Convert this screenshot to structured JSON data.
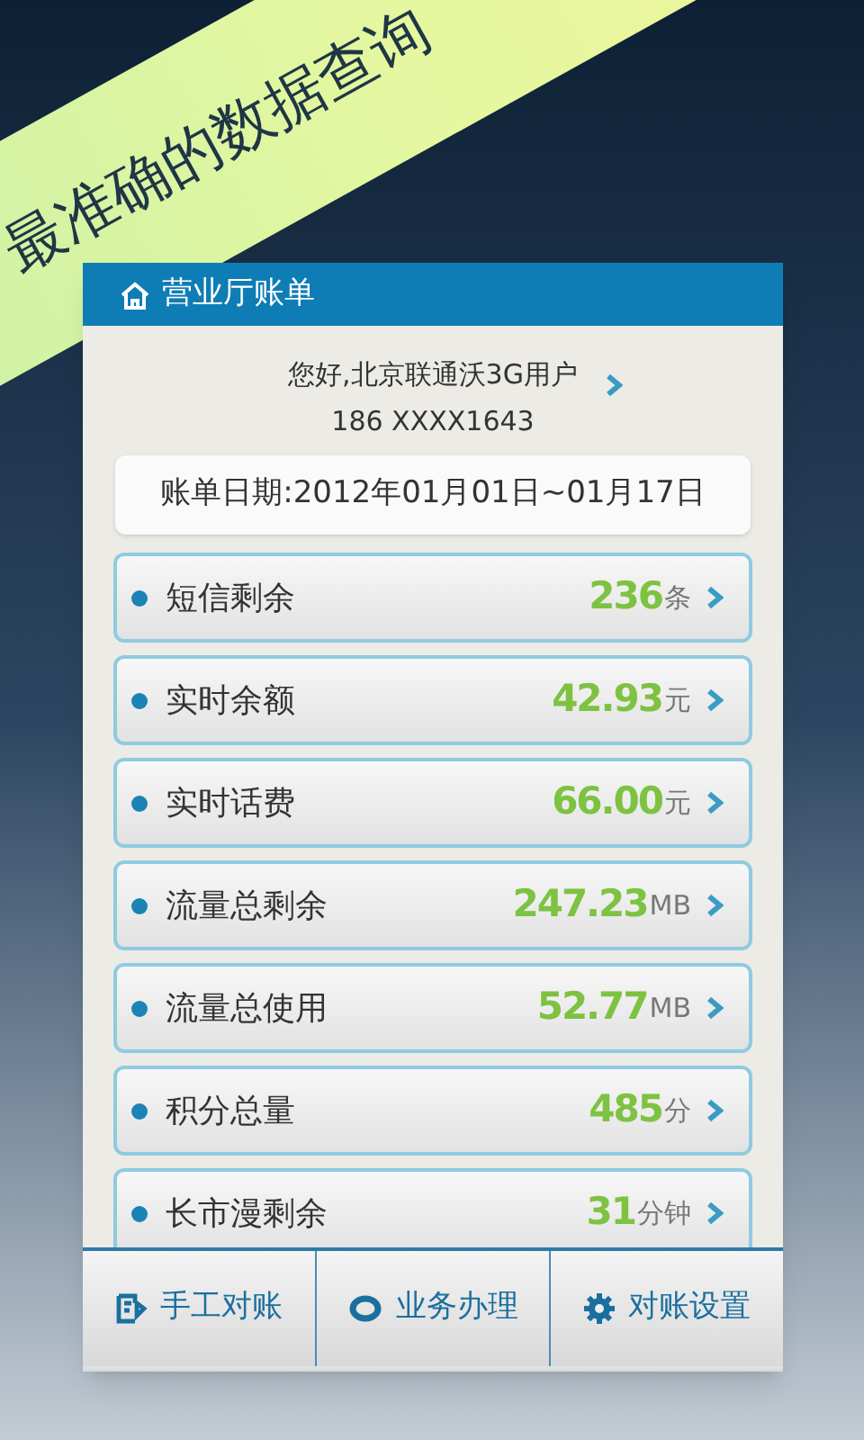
{
  "banner": {
    "text": "最准确的数据查询"
  },
  "header": {
    "title": "营业厅账单"
  },
  "account": {
    "greeting": "您好,北京联通沃3G用户",
    "number": "186 XXXX1643"
  },
  "bill_period": "账单日期:2012年01月01日~01月17日",
  "items": [
    {
      "label": "短信剩余",
      "value": "236",
      "unit": "条"
    },
    {
      "label": "实时余额",
      "value": "42.93",
      "unit": "元"
    },
    {
      "label": "实时话费",
      "value": "66.00",
      "unit": "元"
    },
    {
      "label": "流量总剩余",
      "value": "247.23",
      "unit": "MB"
    },
    {
      "label": "流量总使用",
      "value": "52.77",
      "unit": "MB"
    },
    {
      "label": "积分总量",
      "value": "485",
      "unit": "分"
    },
    {
      "label": "长市漫剩余",
      "value": "31",
      "unit": "分钟"
    }
  ],
  "toolbar": [
    {
      "label": "手工对账",
      "kind": "note"
    },
    {
      "label": "业务办理",
      "kind": "ring"
    },
    {
      "label": "对账设置",
      "kind": "gear"
    }
  ]
}
